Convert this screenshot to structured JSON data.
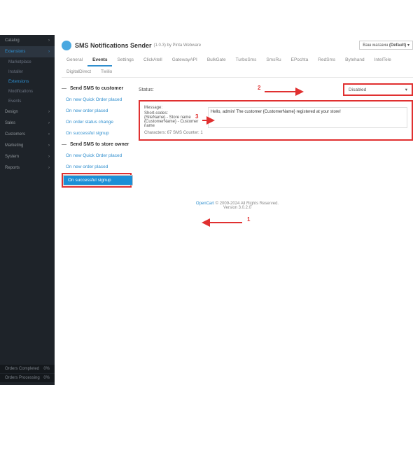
{
  "sidebar": {
    "items": [
      "Catalog",
      "Extensions",
      "Design",
      "Sales",
      "Customers",
      "Marketing",
      "System",
      "Reports"
    ],
    "subs": [
      "Marketplace",
      "Installer",
      "Extensions",
      "Modifications",
      "Events"
    ],
    "stats": [
      {
        "l": "Orders Completed",
        "v": "0%"
      },
      {
        "l": "Orders Processing",
        "v": "0%"
      }
    ]
  },
  "header": {
    "title": "SMS Notifications Sender",
    "ver": "(1.0.3) by Pinta Webware",
    "store_lbl": "Ваш магазин",
    "store_val": "(Default)"
  },
  "tabs": [
    "General",
    "Events",
    "Settings",
    "ClickAtell",
    "GatewayAPI",
    "BulkGate",
    "TurboSms",
    "SmsRu",
    "EPochta",
    "RedSms",
    "Bytehand",
    "IntelTele",
    "DigitalDirect",
    "Twilio"
  ],
  "left": {
    "sect1": "Send SMS to customer",
    "evts1": [
      "On new Quick Order placed",
      "On new order placed",
      "On order status change",
      "On successful signup"
    ],
    "sect2": "Send SMS to store owner",
    "evts2": [
      "On new Quick Order placed",
      "On new order placed",
      "On successful signup"
    ]
  },
  "right": {
    "status_lbl": "Status:",
    "status_val": "Disabled",
    "msg_lbl": "Message:",
    "shortcodes": "Short-codes:\n{SiteName} - Store name\n{CustomerName} - Customer name",
    "msg_val": "Hello, admin! The customer {CustomerName} registered at your store!",
    "counter": "Characters: 67     SMS Counter: 1"
  },
  "footer": {
    "link": "OpenCart",
    "txt": " © 2009-2024 All Rights Reserved.",
    "ver": "Version 3.0.2.0"
  },
  "nums": {
    "n1": "1",
    "n2": "2",
    "n3": "3"
  }
}
